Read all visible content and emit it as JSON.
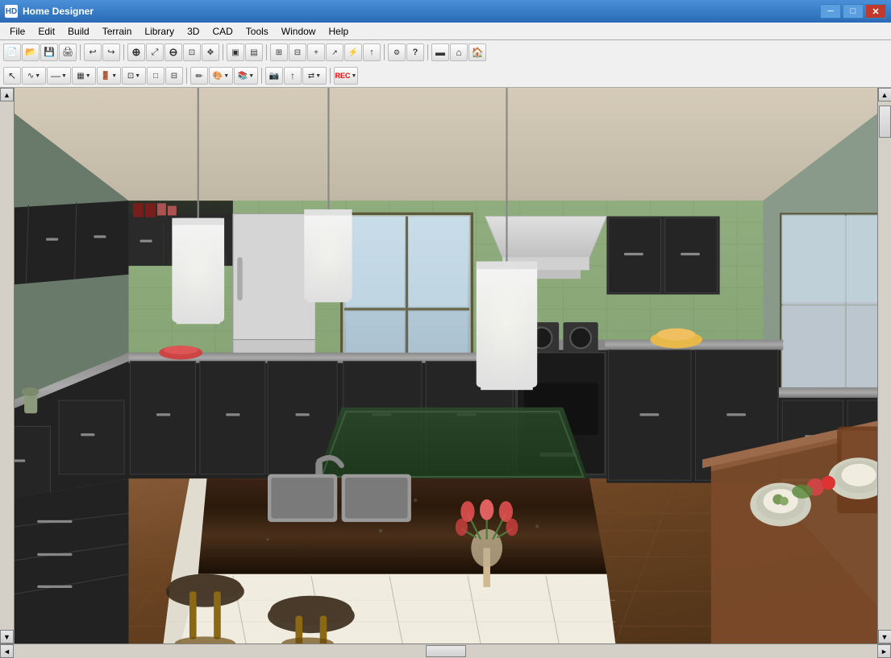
{
  "window": {
    "title": "Home Designer",
    "icon": "HD"
  },
  "title_controls": {
    "minimize": "─",
    "maximize": "□",
    "close": "✕"
  },
  "menu": {
    "items": [
      {
        "id": "file",
        "label": "File"
      },
      {
        "id": "edit",
        "label": "Edit"
      },
      {
        "id": "build",
        "label": "Build"
      },
      {
        "id": "terrain",
        "label": "Terrain"
      },
      {
        "id": "library",
        "label": "Library"
      },
      {
        "id": "3d",
        "label": "3D"
      },
      {
        "id": "cad",
        "label": "CAD"
      },
      {
        "id": "tools",
        "label": "Tools"
      },
      {
        "id": "window",
        "label": "Window"
      },
      {
        "id": "help",
        "label": "Help"
      }
    ]
  },
  "toolbar1": {
    "buttons": [
      {
        "id": "new",
        "icon": "📄",
        "label": "New"
      },
      {
        "id": "open",
        "icon": "📂",
        "label": "Open"
      },
      {
        "id": "save",
        "icon": "💾",
        "label": "Save"
      },
      {
        "id": "print",
        "icon": "🖨",
        "label": "Print"
      },
      {
        "sep": true
      },
      {
        "id": "undo",
        "icon": "↩",
        "label": "Undo"
      },
      {
        "id": "redo",
        "icon": "↪",
        "label": "Redo"
      },
      {
        "sep": true
      },
      {
        "id": "zoom-in",
        "icon": "⊕",
        "label": "Zoom In"
      },
      {
        "id": "zoom-full",
        "icon": "⊞",
        "label": "Zoom Full"
      },
      {
        "id": "zoom-out",
        "icon": "⊖",
        "label": "Zoom Out"
      },
      {
        "id": "zoom-fit",
        "icon": "⤢",
        "label": "Zoom Fit"
      },
      {
        "sep": true
      },
      {
        "id": "select-all",
        "icon": "▣",
        "label": "Select All"
      },
      {
        "id": "move",
        "icon": "✥",
        "label": "Move"
      },
      {
        "id": "add",
        "icon": "+",
        "label": "Add"
      },
      {
        "id": "rotate",
        "icon": "↻",
        "label": "Rotate"
      },
      {
        "id": "delete",
        "icon": "✂",
        "label": "Delete"
      },
      {
        "sep": true
      },
      {
        "id": "snap",
        "icon": "⚡",
        "label": "Snap"
      },
      {
        "id": "measure",
        "icon": "📐",
        "label": "Measure"
      },
      {
        "id": "help",
        "icon": "?",
        "label": "Help"
      },
      {
        "sep": true
      },
      {
        "id": "wall",
        "icon": "▬",
        "label": "Wall"
      },
      {
        "id": "roof",
        "icon": "⌂",
        "label": "Roof"
      },
      {
        "id": "house",
        "icon": "🏠",
        "label": "House"
      }
    ]
  },
  "toolbar2": {
    "buttons": [
      {
        "id": "select",
        "icon": "↖",
        "label": "Select"
      },
      {
        "id": "polyline",
        "icon": "∿",
        "label": "Polyline"
      },
      {
        "id": "line",
        "icon": "—",
        "label": "Line"
      },
      {
        "id": "cabinet",
        "icon": "▦",
        "label": "Cabinet"
      },
      {
        "id": "door",
        "icon": "🚪",
        "label": "Door"
      },
      {
        "id": "window-tool",
        "icon": "⊡",
        "label": "Window"
      },
      {
        "id": "room",
        "icon": "□",
        "label": "Room"
      },
      {
        "id": "stair",
        "icon": "⊟",
        "label": "Stair"
      },
      {
        "id": "material",
        "icon": "✏",
        "label": "Material"
      },
      {
        "id": "color",
        "icon": "🎨",
        "label": "Color"
      },
      {
        "id": "catalog",
        "icon": "📚",
        "label": "Catalog"
      },
      {
        "id": "camera",
        "icon": "📷",
        "label": "Camera"
      },
      {
        "id": "arrow-up",
        "icon": "↑",
        "label": "Arrow Up"
      },
      {
        "id": "transform",
        "icon": "⇄",
        "label": "Transform"
      },
      {
        "id": "record",
        "icon": "⏺",
        "label": "Record"
      }
    ]
  },
  "scene": {
    "description": "3D kitchen interior view",
    "background_color": "#8ba07a"
  },
  "scrollbars": {
    "up_arrow": "▲",
    "down_arrow": "▼",
    "left_arrow": "◄",
    "right_arrow": "►"
  }
}
